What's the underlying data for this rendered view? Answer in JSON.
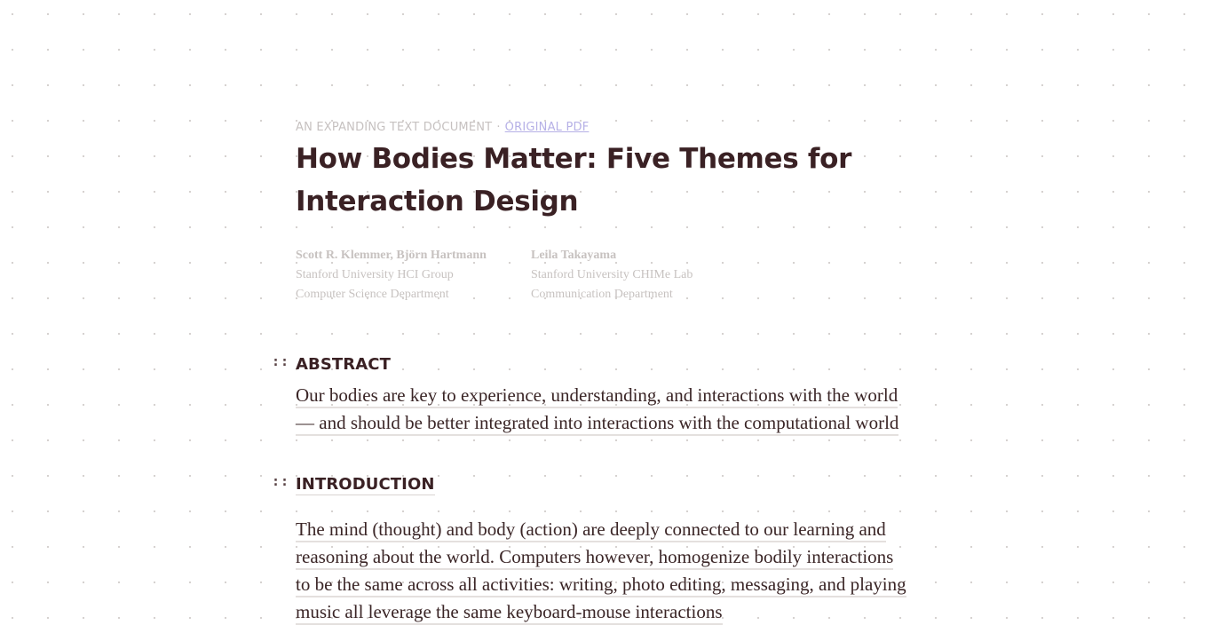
{
  "header": {
    "eyebrow_label": "AN EXPANDING TEXT DOCUMENT",
    "separator": "·",
    "pdf_link": "ORIGINAL PDF"
  },
  "title": "How Bodies Matter: Five Themes for Interaction Design",
  "authors": [
    {
      "names": "Scott R. Klemmer, Björn Hartmann",
      "affiliation": "Stanford University HCI Group",
      "department": "Computer Science Department"
    },
    {
      "names": "Leila Takayama",
      "affiliation": "Stanford University CHIMe Lab",
      "department": "Communication Department"
    }
  ],
  "sections": [
    {
      "handle": "::",
      "heading": "ABSTRACT",
      "lines": [
        "Our bodies are key to experience, understanding, and interactions with the world",
        "— and should be better integrated into interactions with the computational world"
      ]
    },
    {
      "handle": "::",
      "heading": "INTRODUCTION",
      "lines": [
        "The mind (thought) and body (action) are deeply connected to our learning and",
        "reasoning about the world. Computers however, homogenize bodily interactions",
        "to be the same across all activities: writing, photo editing, messaging, and playing",
        "music all leverage the same keyboard-mouse interactions"
      ]
    }
  ]
}
